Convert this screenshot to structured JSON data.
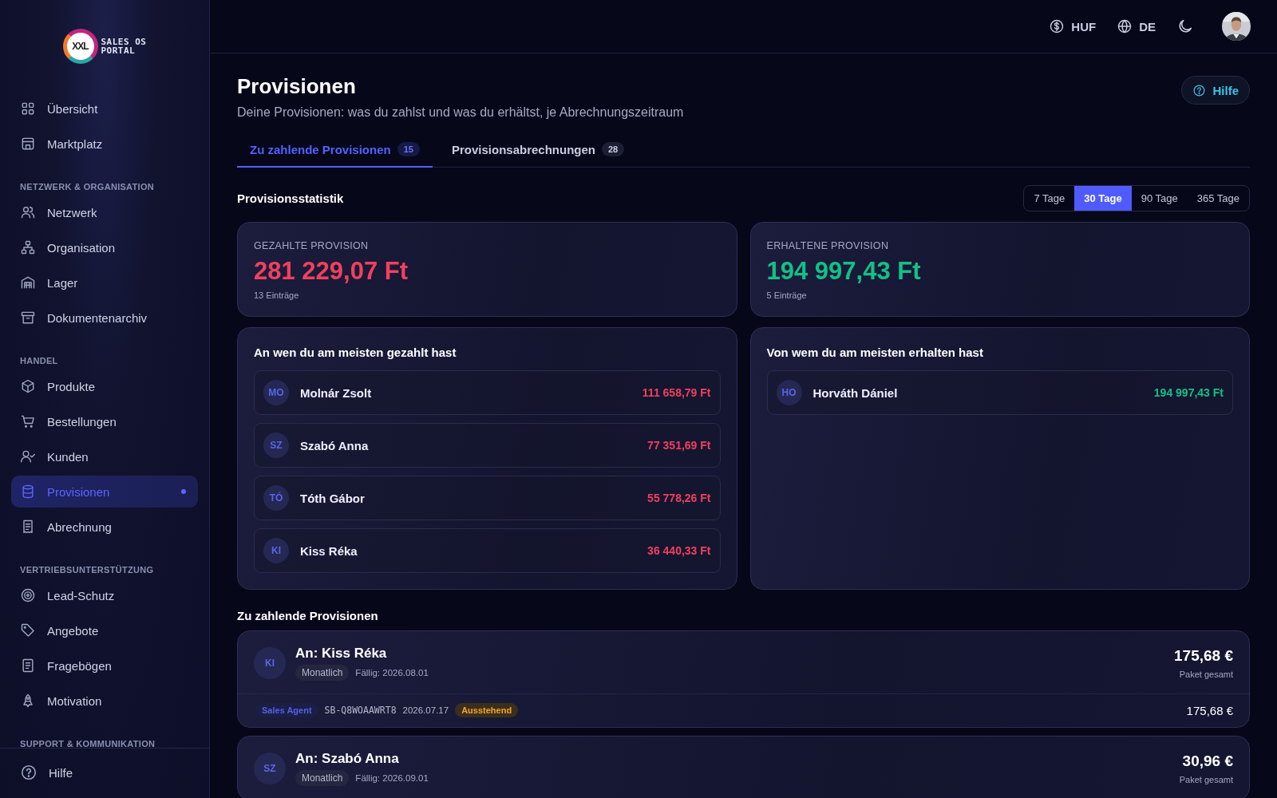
{
  "sidebar": {
    "logo": {
      "mark": "XXL",
      "lines": [
        "SALES OS",
        "PORTAL"
      ]
    },
    "sections": [
      {
        "items": [
          {
            "label": "Übersicht",
            "selected": false
          },
          {
            "label": "Marktplatz",
            "selected": false
          }
        ]
      },
      {
        "label": "NETZWERK & ORGANISATION",
        "items": [
          {
            "label": "Netzwerk",
            "selected": false
          },
          {
            "label": "Organisation",
            "selected": false
          },
          {
            "label": "Lager",
            "selected": false
          },
          {
            "label": "Dokumentenarchiv",
            "selected": false
          }
        ]
      },
      {
        "label": "HANDEL",
        "items": [
          {
            "label": "Produkte",
            "selected": false
          },
          {
            "label": "Bestellungen",
            "selected": false
          },
          {
            "label": "Kunden",
            "selected": false
          },
          {
            "label": "Provisionen",
            "selected": true
          },
          {
            "label": "Abrechnung",
            "selected": false
          }
        ]
      },
      {
        "label": "VERTRIEBSUNTERSTÜTZUNG",
        "items": [
          {
            "label": "Lead-Schutz",
            "selected": false
          },
          {
            "label": "Angebote",
            "selected": false
          },
          {
            "label": "Fragebögen",
            "selected": false
          },
          {
            "label": "Motivation",
            "selected": false
          }
        ]
      },
      {
        "label": "SUPPORT & KOMMUNIKATION"
      }
    ],
    "footer": {
      "label": "Hilfe"
    }
  },
  "header": {
    "currency": "HUF",
    "language": "DE"
  },
  "page": {
    "title": "Provisionen",
    "subtitle": "Deine Provisionen: was du zahlst und was du erhältst, je Abrechnungszeitraum",
    "help_button": "Hilfe"
  },
  "tabs": [
    {
      "label": "Zu zahlende Provisionen",
      "count": "15",
      "selected": true
    },
    {
      "label": "Provisionsabrechnungen",
      "count": "28",
      "selected": false
    }
  ],
  "statistics": {
    "title": "Provisionsstatistik",
    "periods": [
      {
        "label": "7 Tage",
        "selected": false
      },
      {
        "label": "30 Tage",
        "selected": true
      },
      {
        "label": "90 Tage",
        "selected": false
      },
      {
        "label": "365 Tage",
        "selected": false
      }
    ],
    "summary": [
      {
        "kind": "paid",
        "label": "GEZAHLTE PROVISION",
        "amount": "281 229,07 Ft",
        "entries": "13 Einträge"
      },
      {
        "kind": "received",
        "label": "ERHALTENE PROVISION",
        "amount": "194 997,43 Ft",
        "entries": "5 Einträge"
      }
    ],
    "top_lists": [
      {
        "kind": "paid",
        "title": "An wen du am meisten gezahlt hast",
        "people": [
          {
            "initials": "MO",
            "name": "Molnár Zsolt",
            "amount": "111 658,79 Ft"
          },
          {
            "initials": "SZ",
            "name": "Szabó Anna",
            "amount": "77 351,69 Ft"
          },
          {
            "initials": "TÓ",
            "name": "Tóth Gábor",
            "amount": "55 778,26 Ft"
          },
          {
            "initials": "KI",
            "name": "Kiss Réka",
            "amount": "36 440,33 Ft"
          }
        ]
      },
      {
        "kind": "received",
        "title": "Von wem du am meisten erhalten hast",
        "people": [
          {
            "initials": "HO",
            "name": "Horváth Dániel",
            "amount": "194 997,43 Ft"
          }
        ]
      }
    ]
  },
  "payables": {
    "title": "Zu zahlende Provisionen",
    "items": [
      {
        "initials": "KI",
        "recipient": "An: Kiss Réka",
        "frequency": "Monatlich",
        "due": "Fällig: 2026.08.01",
        "total": "175,68 €",
        "total_label": "Paket gesamt",
        "lines": [
          {
            "role": "Sales Agent",
            "code": "SB-Q8WOAAWRT8",
            "date": "2026.07.17",
            "status": "Ausstehend",
            "amount": "175,68 €"
          }
        ]
      },
      {
        "initials": "SZ",
        "recipient": "An: Szabó Anna",
        "frequency": "Monatlich",
        "due": "Fällig: 2026.09.01",
        "total": "30,96 €",
        "total_label": "Paket gesamt"
      }
    ]
  }
}
